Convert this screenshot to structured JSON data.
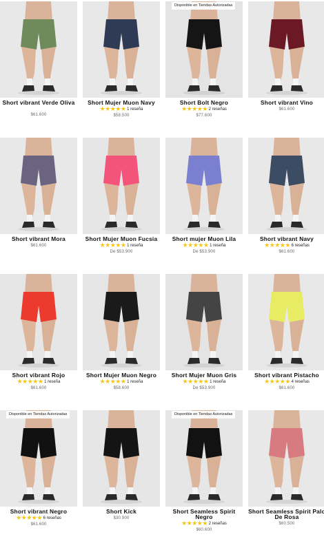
{
  "products": [
    {
      "title": "Short vibrant Verde Oliva",
      "title_lines": 2,
      "rating_stars": "",
      "reviews": "",
      "price": "$61.600",
      "badge": "",
      "color": "#6f8a5b",
      "background": "#e8e8e8"
    },
    {
      "title": "Short Mujer Muon Navy",
      "title_lines": 1,
      "rating_stars": "★★★★★",
      "reviews": "1 reseña",
      "price": "$58.500",
      "badge": "",
      "color": "#2f3a55",
      "background": "#e8e8e8"
    },
    {
      "title": "Short Bolt Negro",
      "title_lines": 1,
      "rating_stars": "★★★★★",
      "reviews": "2 reseñas",
      "price": "$77.600",
      "badge": "Disponible en Tiendas Autorizadas",
      "color": "#151515",
      "background": "#e4e4e4"
    },
    {
      "title": "Short vibrant Vino",
      "title_lines": 1,
      "rating_stars": "",
      "reviews": "",
      "price": "$61.600",
      "badge": "",
      "color": "#6b1a25",
      "background": "#e8e8e8"
    },
    {
      "title": "Short vibrant Mora",
      "title_lines": 1,
      "rating_stars": "",
      "reviews": "",
      "price": "$61.600",
      "badge": "",
      "color": "#6b6480",
      "background": "#e8e8e8"
    },
    {
      "title": "Short Mujer Muon Fucsia",
      "title_lines": 1,
      "rating_stars": "★★★★★",
      "reviews": "1 reseña",
      "price": "De $53.900",
      "badge": "",
      "color": "#f2547a",
      "background": "#e6e6e6"
    },
    {
      "title": "Short mujer Muon Lila",
      "title_lines": 1,
      "rating_stars": "★★★★★",
      "reviews": "1 reseña",
      "price": "De $53.900",
      "badge": "",
      "color": "#7a7fcf",
      "background": "#e8e8e8"
    },
    {
      "title": "Short vibrant Navy",
      "title_lines": 1,
      "rating_stars": "★★★★★",
      "reviews": "6 reseñas",
      "price": "$61.600",
      "badge": "",
      "color": "#3c4d63",
      "background": "#e8e8e8"
    },
    {
      "title": "Short vibrant Rojo",
      "title_lines": 1,
      "rating_stars": "★★★★★",
      "reviews": "1 reseña",
      "price": "$61.600",
      "badge": "",
      "color": "#ec3b2e",
      "background": "#e6e6e6"
    },
    {
      "title": "Short Mujer Muon Negro",
      "title_lines": 1,
      "rating_stars": "★★★★★",
      "reviews": "1 reseña",
      "price": "$58.600",
      "badge": "",
      "color": "#1a1a1a",
      "background": "#e6e6e6"
    },
    {
      "title": "Short Mujer Muon Gris",
      "title_lines": 1,
      "rating_stars": "★★★★★",
      "reviews": "1 reseña",
      "price": "De $53.900",
      "badge": "",
      "color": "#444444",
      "background": "#e4e4e4"
    },
    {
      "title": "Short vibrant Pistacho",
      "title_lines": 1,
      "rating_stars": "★★★★★",
      "reviews": "4 reseñas",
      "price": "$61.600",
      "badge": "",
      "color": "#e7ec62",
      "background": "#e8e8e8"
    },
    {
      "title": "Short vibrant Negro",
      "title_lines": 1,
      "rating_stars": "★★★★★",
      "reviews": "6 reseñas",
      "price": "$61.600",
      "badge": "Disponible en Tiendas Autorizadas",
      "color": "#111111",
      "background": "#e8e8e8"
    },
    {
      "title": "Short Kick",
      "title_lines": 1,
      "rating_stars": "",
      "reviews": "",
      "price": "$30.900",
      "badge": "",
      "color": "#141414",
      "background": "#e6e6e6"
    },
    {
      "title": "Short Seamless Spirit Negro",
      "title_lines": 2,
      "rating_stars": "★★★★★",
      "reviews": "2 reseñas",
      "price": "$60.600",
      "badge": "Disponible en Tiendas Autorizadas",
      "color": "#121212",
      "background": "#e6e6e6"
    },
    {
      "title": "Short Seamless Spirit Palo De Rosa",
      "title_lines": 2,
      "rating_stars": "",
      "reviews": "",
      "price": "$60.500",
      "badge": "",
      "color": "#d77b80",
      "background": "#e8e8e8"
    }
  ]
}
